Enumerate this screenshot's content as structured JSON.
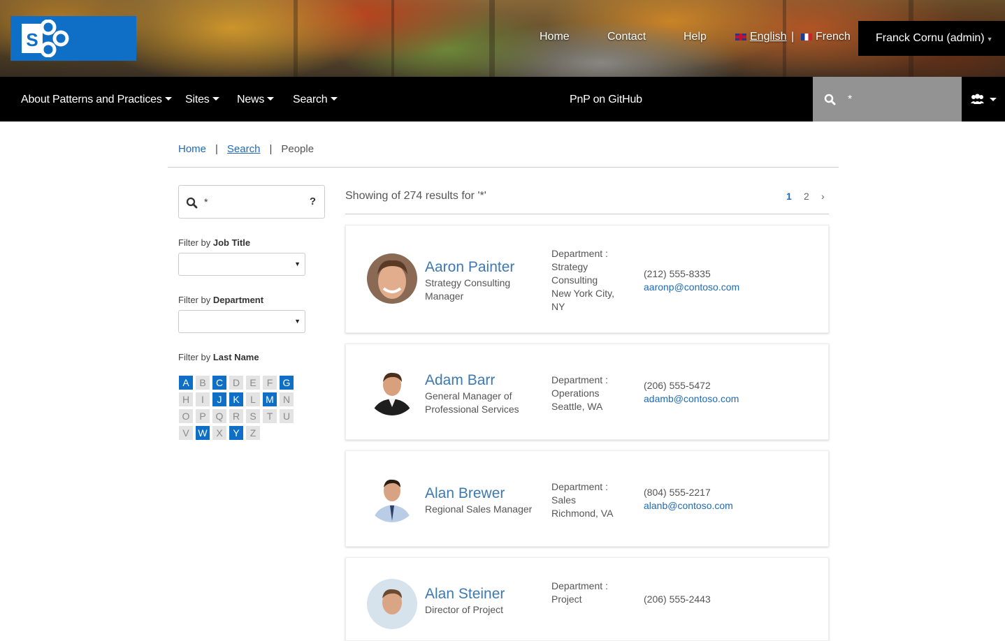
{
  "top_nav": {
    "home": "Home",
    "contact": "Contact",
    "help": "Help",
    "english": "English",
    "separator": "|",
    "french": "French",
    "user": "Franck Cornu (admin)"
  },
  "main_nav": {
    "about": "About Patterns and Practices",
    "sites": "Sites",
    "news": "News",
    "search": "Search",
    "github": "PnP on GitHub",
    "search_value": "*"
  },
  "breadcrumb": {
    "home": "Home",
    "sep": "|",
    "search": "Search",
    "current": "People"
  },
  "sidebar": {
    "search_value": "*",
    "help": "?",
    "filter_job_prefix": "Filter by ",
    "filter_job": "Job Title",
    "filter_dept_prefix": "Filter by ",
    "filter_dept": "Department",
    "filter_last_prefix": "Filter by ",
    "filter_last": "Last Name",
    "letters": [
      {
        "l": "A",
        "active": true
      },
      {
        "l": "B",
        "active": false
      },
      {
        "l": "C",
        "active": true
      },
      {
        "l": "D",
        "active": false
      },
      {
        "l": "E",
        "active": false
      },
      {
        "l": "F",
        "active": false
      },
      {
        "l": "G",
        "active": true
      },
      {
        "l": "H",
        "active": false
      },
      {
        "l": "I",
        "active": false
      },
      {
        "l": "J",
        "active": true
      },
      {
        "l": "K",
        "active": true
      },
      {
        "l": "L",
        "active": false
      },
      {
        "l": "M",
        "active": true
      },
      {
        "l": "N",
        "active": false
      },
      {
        "l": "O",
        "active": false
      },
      {
        "l": "P",
        "active": false
      },
      {
        "l": "Q",
        "active": false
      },
      {
        "l": "R",
        "active": false
      },
      {
        "l": "S",
        "active": false
      },
      {
        "l": "T",
        "active": false
      },
      {
        "l": "U",
        "active": false
      },
      {
        "l": "V",
        "active": false
      },
      {
        "l": "W",
        "active": true
      },
      {
        "l": "X",
        "active": false
      },
      {
        "l": "Y",
        "active": true
      },
      {
        "l": "Z",
        "active": false
      }
    ]
  },
  "results": {
    "summary": "Showing of 274 results for '*'",
    "pages": [
      "1",
      "2",
      "›"
    ],
    "people": [
      {
        "name": "Aaron Painter",
        "title": "Strategy Consulting Manager",
        "dept_label": "Department :",
        "dept": "Strategy Consulting",
        "location": "New York City, NY",
        "phone": "(212) 555-8335",
        "email": "aaronp@contoso.com"
      },
      {
        "name": "Adam Barr",
        "title": "General Manager of Professional Services",
        "dept_label": "Department :",
        "dept": "Operations",
        "location": "Seattle, WA",
        "phone": "(206) 555-5472",
        "email": "adamb@contoso.com"
      },
      {
        "name": "Alan Brewer",
        "title": "Regional Sales Manager",
        "dept_label": "Department :",
        "dept": "Sales",
        "location": "Richmond, VA",
        "phone": "(804) 555-2217",
        "email": "alanb@contoso.com"
      },
      {
        "name": "Alan Steiner",
        "title": "Director of Project",
        "dept_label": "Department :",
        "dept": "Project",
        "location": "",
        "phone": "(206) 555-2443",
        "email": ""
      }
    ]
  },
  "colors": {
    "accent": "#0f6fc6",
    "link": "#1f6ab8",
    "name": "#3d78b2",
    "nav_bg": "#000000",
    "search_bg": "#939393",
    "letter_off": "#e3e3e3"
  },
  "icons": [
    "sharepoint-logo",
    "uk-flag-icon",
    "french-flag-icon",
    "caret-down-icon",
    "search-icon",
    "people-icon",
    "help-icon",
    "chevron-right-icon"
  ]
}
